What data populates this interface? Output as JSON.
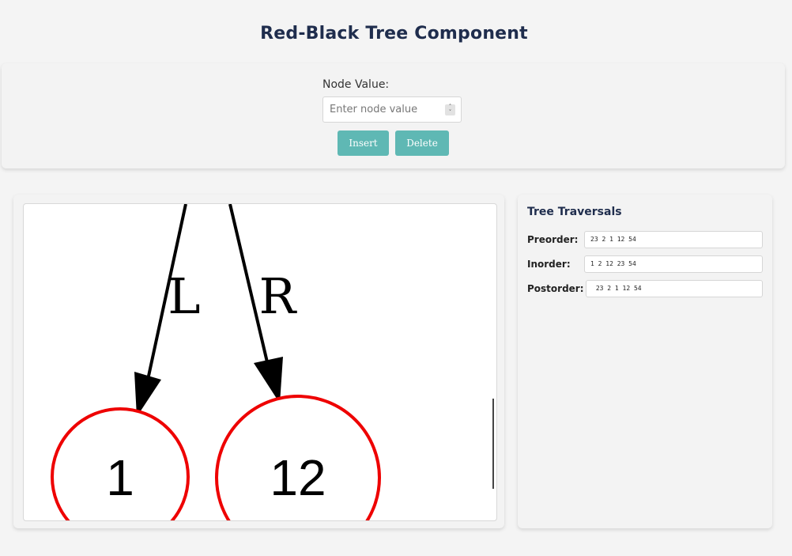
{
  "header": {
    "title": "Red-Black Tree Component"
  },
  "controls": {
    "label": "Node Value:",
    "input_value": "",
    "input_placeholder": "Enter node value",
    "insert_label": "Insert",
    "delete_label": "Delete",
    "button_color": "#5fb8b4"
  },
  "tree": {
    "edges": [
      {
        "label": "L",
        "to": "1"
      },
      {
        "label": "R",
        "to": "12"
      }
    ],
    "nodes": [
      {
        "value": "1",
        "color": "red"
      },
      {
        "value": "12",
        "color": "red"
      }
    ],
    "node_stroke_color": "#ee0000"
  },
  "traversals": {
    "title": "Tree Traversals",
    "preorder_label": "Preorder:",
    "preorder_value": "23 2 1 12 54",
    "inorder_label": "Inorder:",
    "inorder_value": "1 2 12 23 54",
    "postorder_label": "Postorder:",
    "postorder_value": " 23 2 1 12 54"
  }
}
